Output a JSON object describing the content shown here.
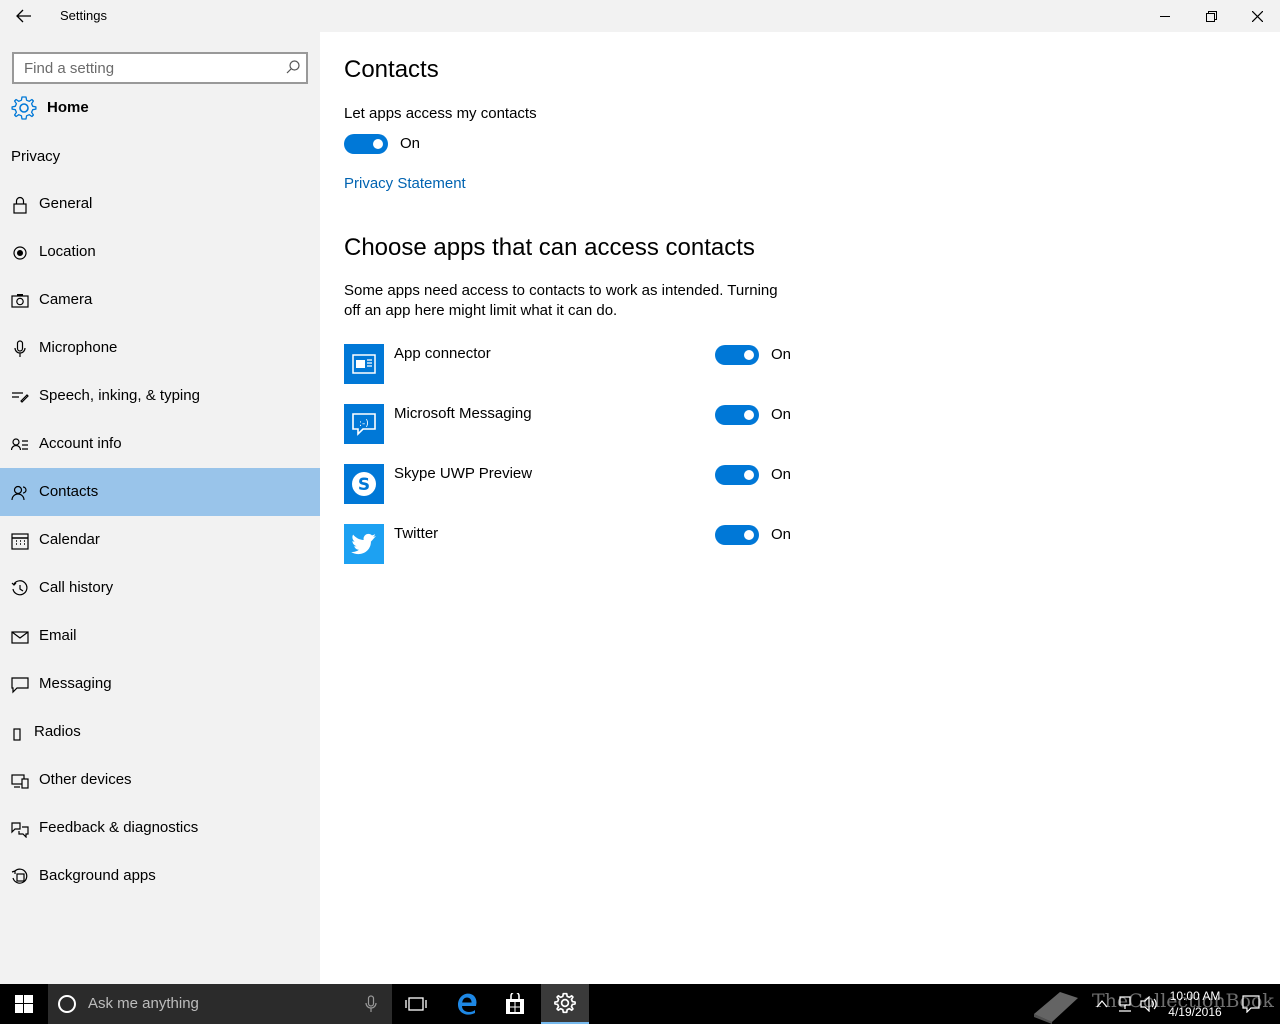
{
  "window": {
    "title": "Settings"
  },
  "sidebar": {
    "search_placeholder": "Find a setting",
    "home_label": "Home",
    "section_label": "Privacy",
    "items": [
      {
        "label": "General",
        "icon": "lock-icon"
      },
      {
        "label": "Location",
        "icon": "location-icon"
      },
      {
        "label": "Camera",
        "icon": "camera-icon"
      },
      {
        "label": "Microphone",
        "icon": "microphone-icon"
      },
      {
        "label": "Speech, inking, & typing",
        "icon": "speech-icon"
      },
      {
        "label": "Account info",
        "icon": "account-info-icon"
      },
      {
        "label": "Contacts",
        "icon": "contacts-icon",
        "selected": true
      },
      {
        "label": "Calendar",
        "icon": "calendar-icon"
      },
      {
        "label": "Call history",
        "icon": "history-icon"
      },
      {
        "label": "Email",
        "icon": "email-icon"
      },
      {
        "label": "Messaging",
        "icon": "messaging-icon"
      },
      {
        "label": "Radios",
        "icon": "radios-icon"
      },
      {
        "label": "Other devices",
        "icon": "devices-icon"
      },
      {
        "label": "Feedback & diagnostics",
        "icon": "feedback-icon"
      },
      {
        "label": "Background apps",
        "icon": "background-apps-icon"
      }
    ]
  },
  "main": {
    "title": "Contacts",
    "master_toggle_label": "Let apps access my contacts",
    "master_toggle_state": "On",
    "privacy_link": "Privacy Statement",
    "apps_heading": "Choose apps that can access contacts",
    "apps_description": "Some apps need access to contacts to work as intended. Turning off an app here might limit what it can do.",
    "apps": [
      {
        "name": "App connector",
        "state": "On",
        "icon": "app-connector-icon"
      },
      {
        "name": "Microsoft Messaging",
        "state": "On",
        "icon": "messaging-app-icon"
      },
      {
        "name": "Skype UWP Preview",
        "state": "On",
        "icon": "skype-icon"
      },
      {
        "name": "Twitter",
        "state": "On",
        "icon": "twitter-icon"
      }
    ]
  },
  "taskbar": {
    "search_placeholder": "Ask me anything",
    "time": "10:00 AM",
    "date": "4/19/2016",
    "watermark": "TheCollectionBook"
  },
  "colors": {
    "accent": "#0078d7",
    "selected_bg": "#99c4ea",
    "sidebar_bg": "#f2f2f2",
    "link": "#0063b1"
  }
}
